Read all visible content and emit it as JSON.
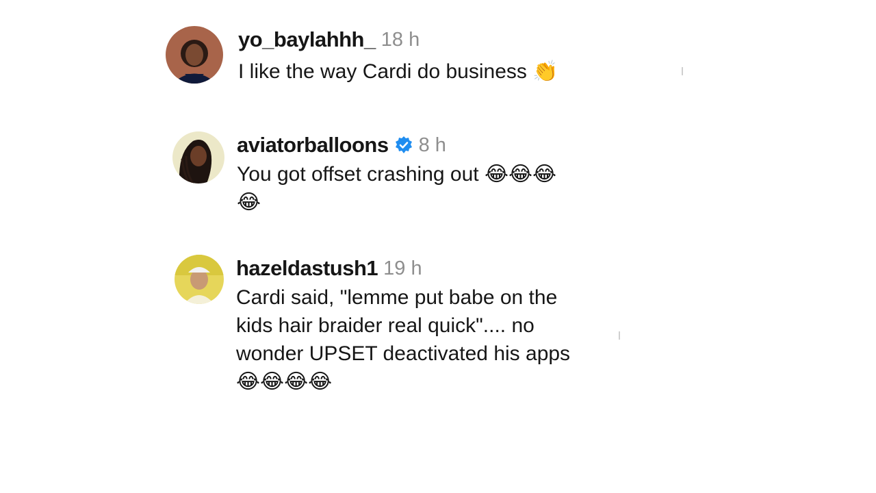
{
  "comments": [
    {
      "username": "yo_baylahhh_",
      "time": "18 h",
      "text": "I like the way Cardi do business",
      "emoji": "👏",
      "avatar": "avatar-woman-dark-hair"
    },
    {
      "username": "aviatorballoons",
      "verified": true,
      "time": "8 h",
      "text": "You got offset crashing out",
      "emoji_line1": "😂😂😂",
      "emoji_line2": "😂",
      "avatar": "avatar-woman-braids"
    },
    {
      "username": "hazeldastush1",
      "time": "19 h",
      "text_line1": "Cardi said, \"lemme put babe on the",
      "text_line2": "kids hair braider real quick\".... no",
      "text_line3": "wonder UPSET deactivated his apps",
      "emoji": "😂😂😂😂",
      "avatar": "avatar-person-yellow"
    }
  ],
  "colors": {
    "text": "#161616",
    "timestamp": "#8e8e8e",
    "verified": "#1f8df0",
    "background": "#ffffff"
  }
}
